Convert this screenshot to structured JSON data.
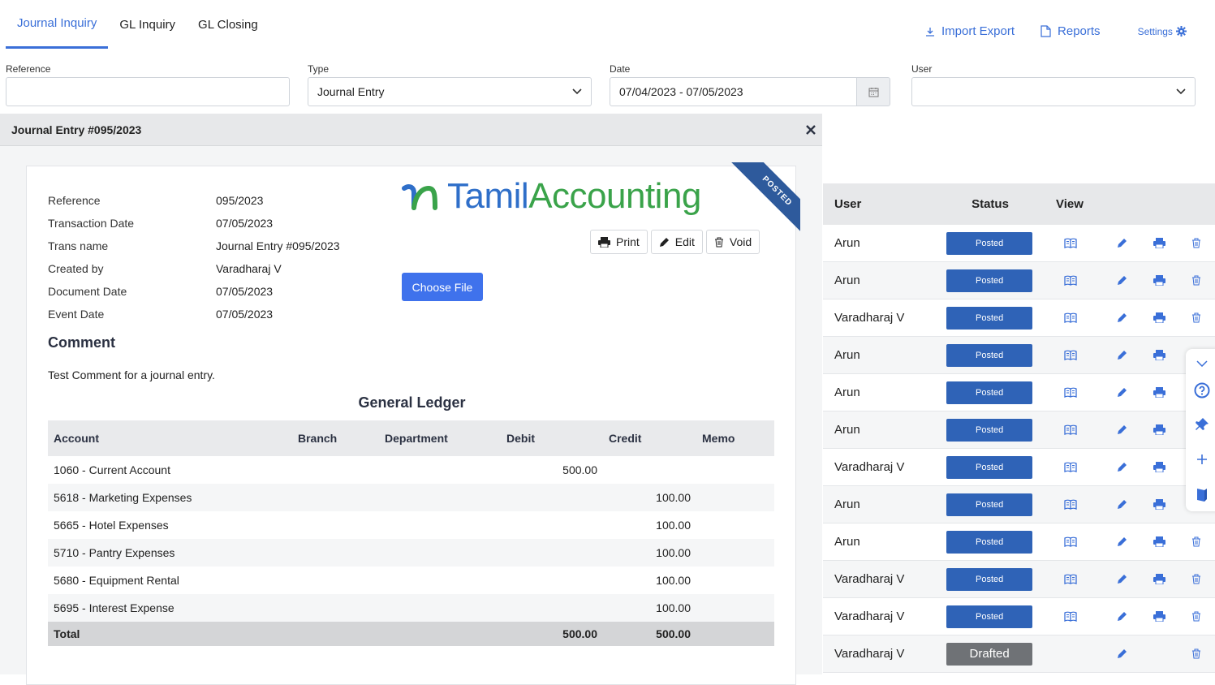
{
  "tabs": [
    "Journal Inquiry",
    "GL Inquiry",
    "GL Closing"
  ],
  "top_links": {
    "import_export": "Import Export",
    "reports": "Reports",
    "settings": "Settings"
  },
  "filters": {
    "reference_label": "Reference",
    "reference_value": "",
    "type_label": "Type",
    "type_value": "Journal Entry",
    "date_label": "Date",
    "date_value": "07/04/2023 - 07/05/2023",
    "user_label": "User",
    "user_value": ""
  },
  "panel": {
    "title": "Journal Entry #095/2023",
    "info": [
      {
        "label": "Reference",
        "value": "095/2023"
      },
      {
        "label": "Transaction Date",
        "value": "07/05/2023"
      },
      {
        "label": "Trans name",
        "value": "Journal Entry #095/2023"
      },
      {
        "label": "Created by",
        "value": "Varadharaj V"
      },
      {
        "label": "Document Date",
        "value": "07/05/2023"
      },
      {
        "label": "Event Date",
        "value": "07/05/2023"
      }
    ],
    "logo_tamil": "Tamil",
    "logo_accounting": "Accounting",
    "ribbon": "POSTED",
    "actions": {
      "print": "Print",
      "edit": "Edit",
      "void": "Void"
    },
    "choose_file": "Choose File",
    "comment_heading": "Comment",
    "comment_text": "Test Comment for a journal entry.",
    "gl_heading": "General Ledger",
    "gl_columns": [
      "Account",
      "Branch",
      "Department",
      "Debit",
      "Credit",
      "Memo"
    ],
    "gl_rows": [
      {
        "account": "1060 - Current Account",
        "debit": "500.00",
        "credit": ""
      },
      {
        "account": "5618 - Marketing Expenses",
        "debit": "",
        "credit": "100.00"
      },
      {
        "account": "5665 - Hotel Expenses",
        "debit": "",
        "credit": "100.00"
      },
      {
        "account": "5710 - Pantry Expenses",
        "debit": "",
        "credit": "100.00"
      },
      {
        "account": "5680 - Equipment Rental",
        "debit": "",
        "credit": "100.00"
      },
      {
        "account": "5695 - Interest Expense",
        "debit": "",
        "credit": "100.00"
      }
    ],
    "gl_total": {
      "label": "Total",
      "debit": "500.00",
      "credit": "500.00"
    }
  },
  "list": {
    "columns": {
      "user": "User",
      "status": "Status",
      "view": "View"
    },
    "rows": [
      {
        "user": "Arun",
        "status": "Posted",
        "trash": true
      },
      {
        "user": "Arun",
        "status": "Posted",
        "trash": true
      },
      {
        "user": "Varadharaj V",
        "status": "Posted",
        "trash": true
      },
      {
        "user": "Arun",
        "status": "Posted",
        "trash": false
      },
      {
        "user": "Arun",
        "status": "Posted",
        "trash": false
      },
      {
        "user": "Arun",
        "status": "Posted",
        "trash": false
      },
      {
        "user": "Varadharaj V",
        "status": "Posted",
        "trash": false
      },
      {
        "user": "Arun",
        "status": "Posted",
        "trash": false
      },
      {
        "user": "Arun",
        "status": "Posted",
        "trash": true
      },
      {
        "user": "Varadharaj V",
        "status": "Posted",
        "trash": true
      },
      {
        "user": "Varadharaj V",
        "status": "Posted",
        "trash": true
      },
      {
        "user": "Varadharaj V",
        "status": "Drafted",
        "trash": true
      }
    ]
  },
  "colors": {
    "accent": "#3a6fd8",
    "posted": "#2f63b7",
    "drafted": "#6f7276",
    "logo_blue": "#2f6fc9",
    "logo_green": "#3aa34a"
  }
}
